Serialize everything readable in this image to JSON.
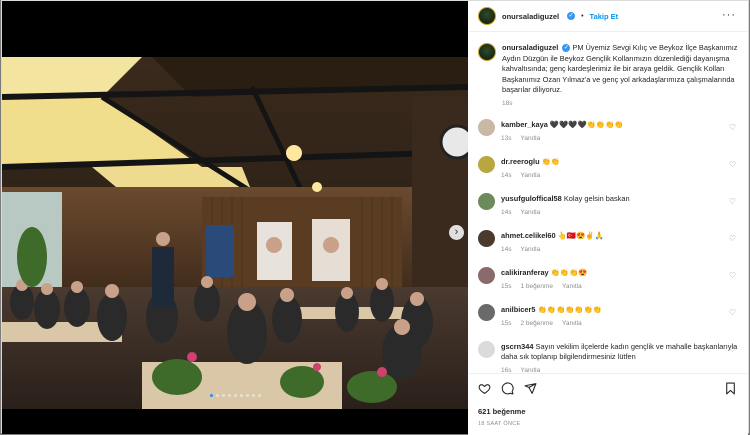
{
  "post": {
    "username": "onursaladiguzel",
    "follow_label": "Takip Et",
    "more_label": "···",
    "verified_mark": "✓",
    "caption": "PM Üyemiz Sevgi Kılıç ve Beykoz İlçe Başkanımız Aydın Düzgün ile Beykoz Gençlik Kollarımızın düzenlediği dayanışma kahvaltısında; genç kardeşlerimiz ile bir araya geldik. Gençlik Kolları Başkanımız Ozan Yılmaz'a ve genç yol arkadaşlarımıza çalışmalarında başarılar diliyoruz.",
    "caption_age": "18s",
    "likes": "621 beğenme",
    "time_ago": "18 SAAT ÖNCE",
    "next_label": "›"
  },
  "comments": [
    {
      "user": "kamber_kaya",
      "text": "🖤🖤🖤🖤👏👏👏👏",
      "age": "13s",
      "reply": "Yanıtla",
      "likes": "",
      "avatar_color": "#c9b8a4"
    },
    {
      "user": "dr.reeroglu",
      "text": "👏👏",
      "age": "14s",
      "reply": "Yanıtla",
      "likes": "",
      "avatar_color": "#b8a640"
    },
    {
      "user": "yusufguloffical58",
      "text": "Kolay gelsin baskan",
      "age": "14s",
      "reply": "Yanıtla",
      "likes": "",
      "avatar_color": "#6c8a5a"
    },
    {
      "user": "ahmet.celikel60",
      "text": "👆🇹🇷😍✌️🙏",
      "age": "14s",
      "reply": "Yanıtla",
      "likes": "",
      "avatar_color": "#4a3a2e"
    },
    {
      "user": "calikiranferay",
      "text": "👏👏👏😍",
      "age": "15s",
      "reply": "Yanıtla",
      "likes": "1 beğenme",
      "avatar_color": "#8a6a6a"
    },
    {
      "user": "anilbicer5",
      "text": "👏👏👏👏👏👏👏",
      "age": "15s",
      "reply": "Yanıtla",
      "likes": "2 beğenme",
      "avatar_color": "#6a6a6a"
    },
    {
      "user": "gscrn344",
      "text": "Sayın vekilim ilçelerde kadın gençlik ve mahalle başkanlarıyla daha sık toplanıp bilgilendirmesiniz lütfen",
      "age": "16s",
      "reply": "Yanıtla",
      "likes": "",
      "avatar_color": "#dbdbdb"
    }
  ]
}
